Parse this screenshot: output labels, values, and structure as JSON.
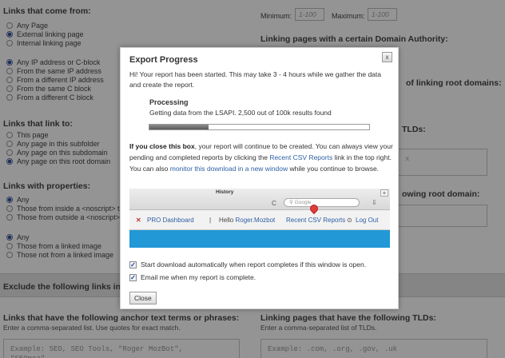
{
  "background": {
    "links_come_from": {
      "title": "Links that come from:",
      "group1": [
        "Any Page",
        "External linking page",
        "Internal linking page"
      ],
      "group1_selected": 1,
      "group2": [
        "Any IP address or C-block",
        "From the same IP address",
        "From a different IP address",
        "From the same C block",
        "From a different C block"
      ],
      "group2_selected": 0
    },
    "links_link_to": {
      "title": "Links that link to:",
      "options": [
        "This page",
        "Any page in this subfolder",
        "Any page on this subdomain",
        "Any page on this root domain"
      ],
      "selected": 3
    },
    "links_properties": {
      "title": "Links with properties:",
      "group1": [
        "Any",
        "Those from inside a <noscript> ta",
        "Those from outside a <noscript>"
      ],
      "group1_selected": 0,
      "group2": [
        "Any",
        "Those from a linked image",
        "Those not from a linked image"
      ],
      "group2_selected": 0
    },
    "right": {
      "minimum_label": "Minimum:",
      "minimum_placeholder": "1-100",
      "maximum_label": "Maximum:",
      "maximum_placeholder": "1-100",
      "domain_authority_title": "Linking pages with a certain Domain Authority:",
      "root_domains_fragment": "of linking root domains:",
      "tlds_fragment": "TLDs:",
      "x_fragment": "x",
      "root_domain_fragment": "owing root domain:"
    },
    "exclude_band": "Exclude the following links in",
    "anchor": {
      "title": "Links that have the following anchor text terms or phrases:",
      "hint": "Enter a comma-separated list. Use quotes for exact match.",
      "placeholder": "Example: SEO, SEO Tools, \"Roger MozBot\",\n\"SEOmoz\""
    },
    "tld": {
      "title": "Linking pages that have the following TLDs:",
      "hint": "Enter a comma-separated list of TLDs.",
      "placeholder": "Example: .com, .org, .gov, .uk"
    }
  },
  "modal": {
    "title": "Export Progress",
    "close_x": "x",
    "intro": "Hi! Your report has been started. This may take 3 - 4 hours while we gather the data and create the report.",
    "processing_title": "Processing",
    "processing_text": "Getting data from the LSAPI. 2,500 out of 100k results found",
    "progress": 0.27,
    "info": {
      "bold": "If you close this box",
      "part1": ", your report will continue to be created. You can always view your pending and completed reports by clicking the ",
      "link1": "Recent CSV Reports",
      "part2": " link in the top right. You can also ",
      "link2": "monitor this download in a new window",
      "part3": " while you continue to browse."
    },
    "browser": {
      "tab_title": "History",
      "plus": "+",
      "refresh": "C",
      "search_placeholder": "Google",
      "download_icon": "⇩",
      "pro_dashboard": "PRO Dashboard",
      "hello": "Hello",
      "user": "Roger.Mozbot",
      "recent": "Recent CSV Reports",
      "logout": "Log Out"
    },
    "checkbox1": "Start download automatically when report completes if this window is open.",
    "checkbox2": "Email me when my report is complete.",
    "close_button": "Close"
  }
}
